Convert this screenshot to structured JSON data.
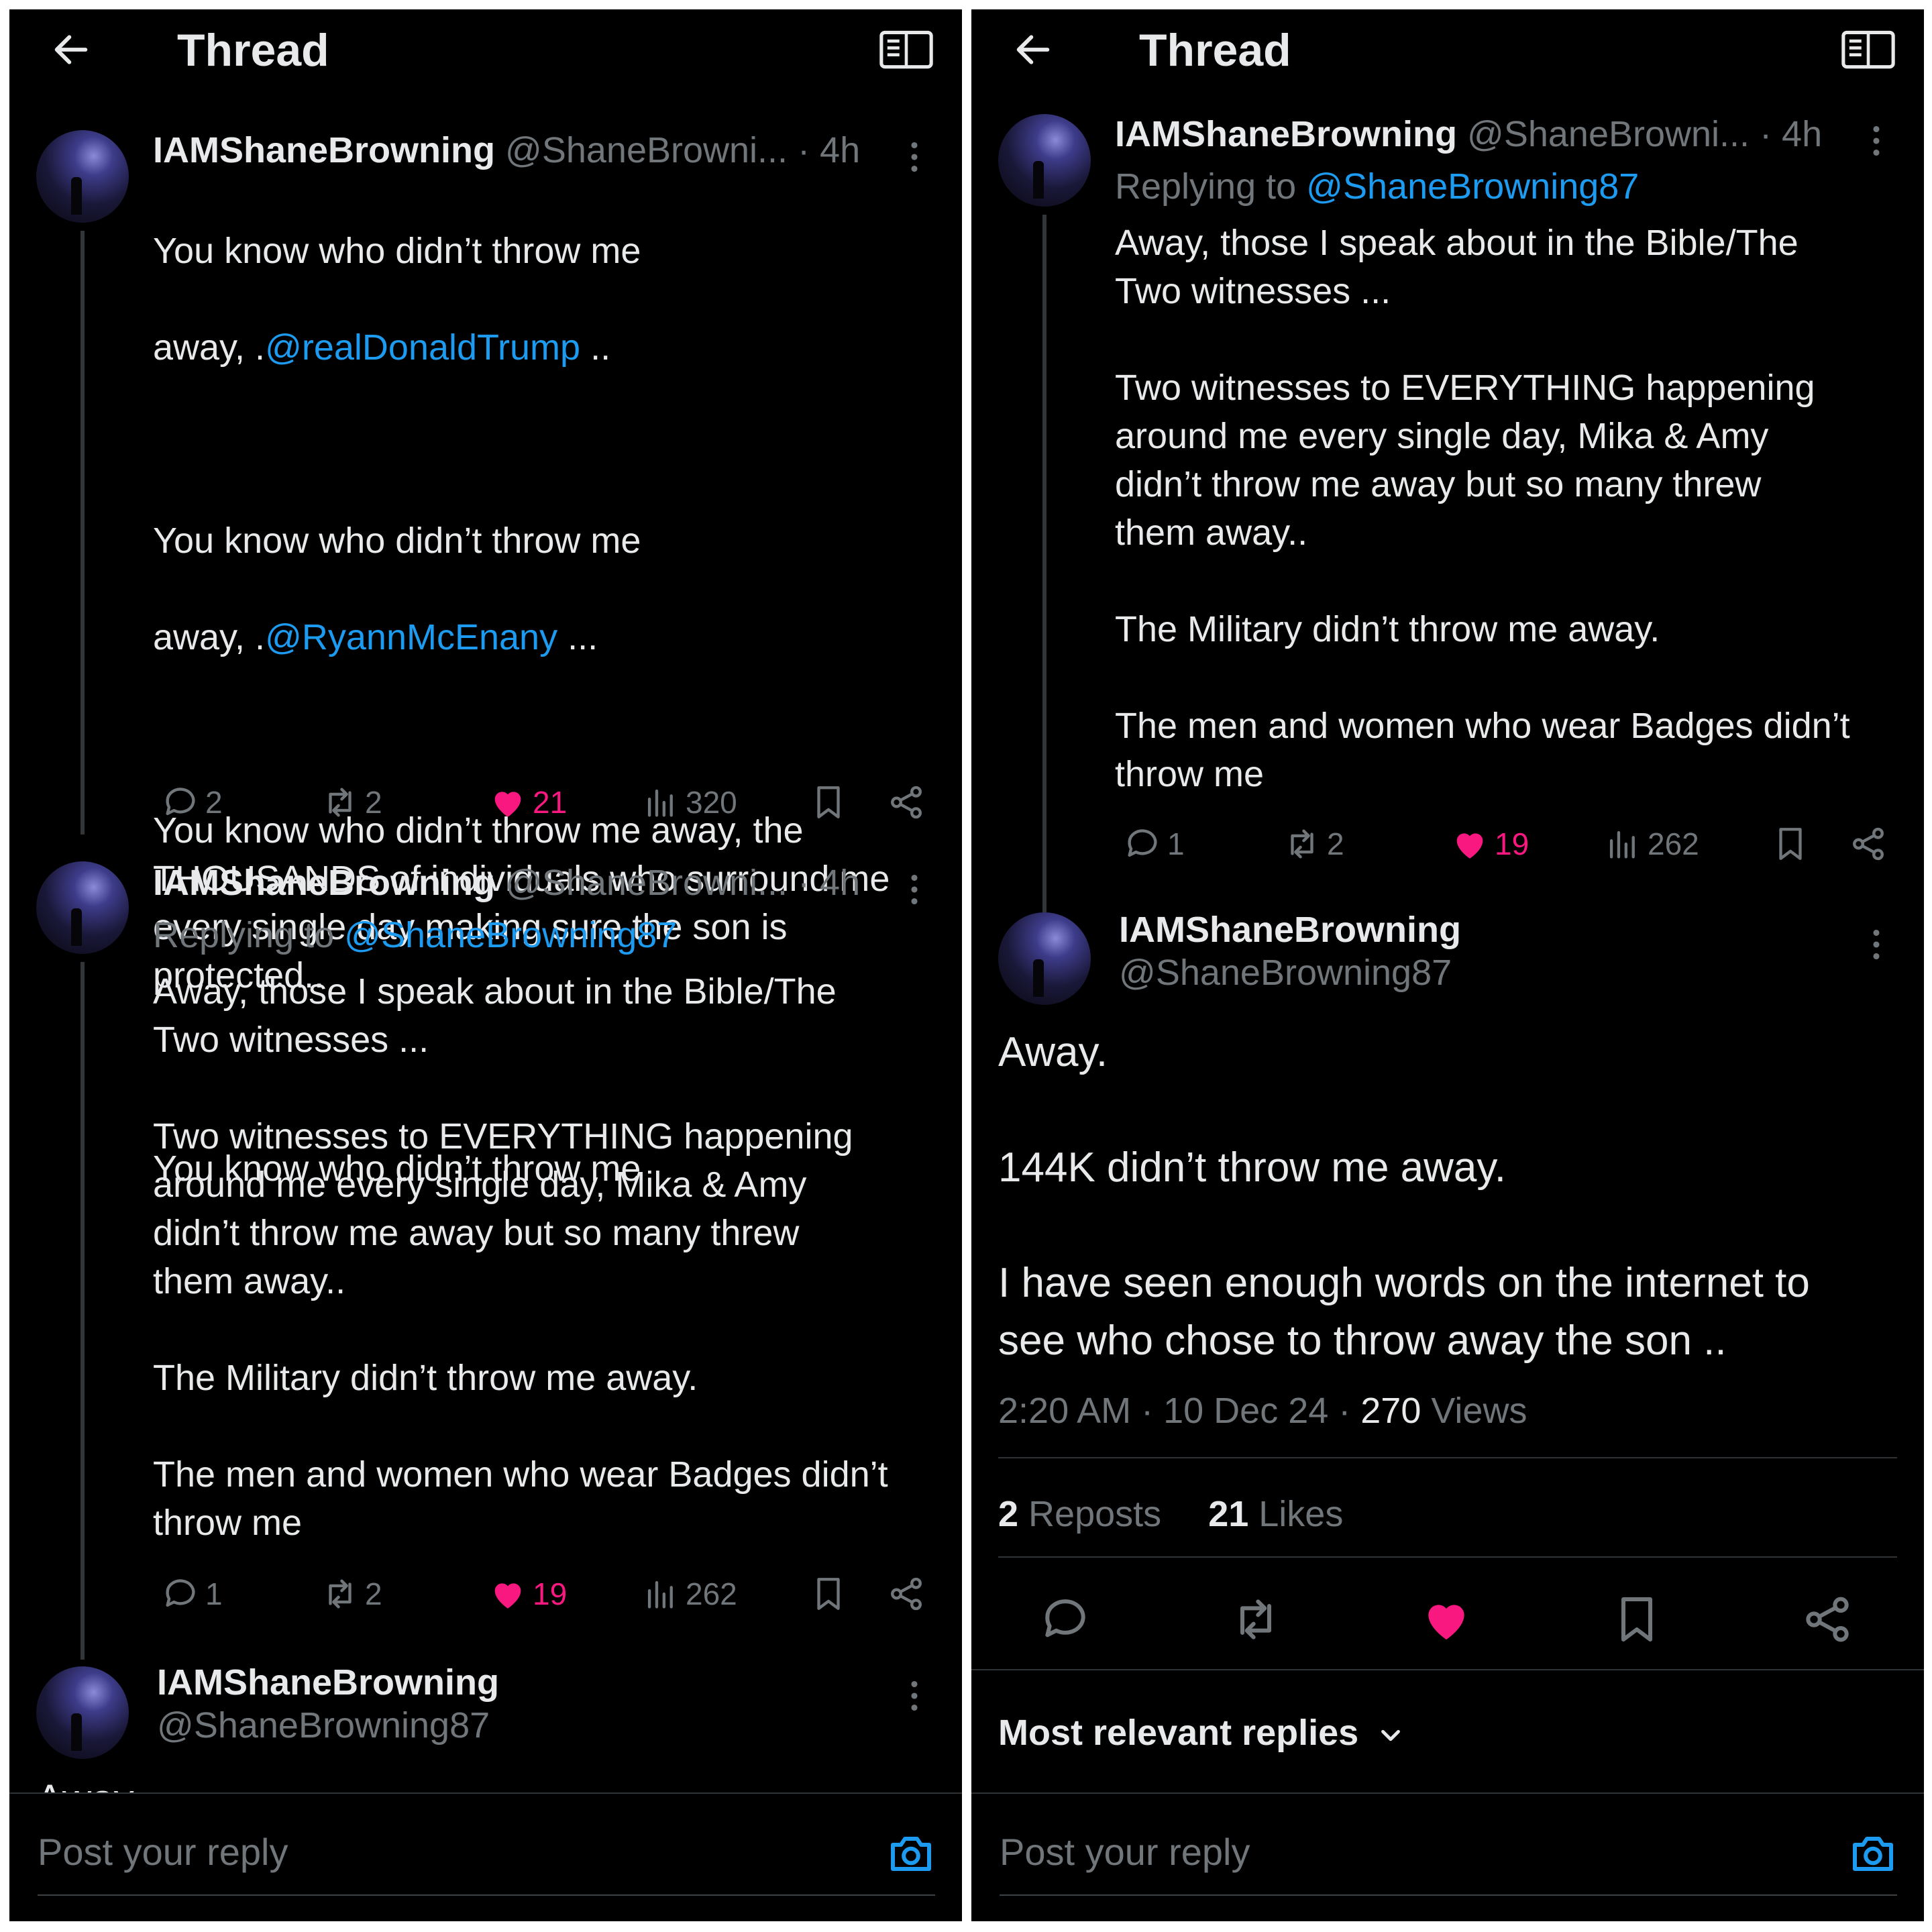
{
  "header": {
    "title": "Thread"
  },
  "left": {
    "tweet1": {
      "name": "IAMShaneBrowning",
      "handle": "@ShaneBrowni...",
      "time": "· 4h",
      "p1a": "You know who didn’t throw me",
      "p1b": "away, .",
      "p1link": "@realDonaldTrump",
      "p1end": " ..",
      "p2a": "You know who didn’t throw me",
      "p2b": "away, .",
      "p2link": "@RyannMcEnany",
      "p2end": "  ...",
      "p3": "You know who didn’t throw me away, the\nTHOUSANDS of individuals who surround me\nevery single day making sure the son is\nprotected..",
      "p4": "You know who didn’t throw me",
      "replies": "2",
      "reposts": "2",
      "likes": "21",
      "views": "320"
    },
    "tweet2": {
      "name": "IAMShaneBrowning",
      "handle": "@ShaneBrowni...",
      "time": "· 4h",
      "replying_prefix": "Replying to ",
      "replying_to": "@ShaneBrowning87",
      "text": "Away, those I speak about in the Bible/The\nTwo witnesses ...\n\nTwo witnesses to EVERYTHING happening\naround me every single day, Mika & Amy\ndidn’t throw me away but so many threw\nthem away..\n\nThe Military didn’t throw me away.\n\nThe men and women who wear Badges didn’t\nthrow me",
      "replies": "1",
      "reposts": "2",
      "likes": "19",
      "views": "262"
    },
    "tweet3": {
      "name": "IAMShaneBrowning",
      "handle": "@ShaneBrowning87",
      "peek": "Away."
    },
    "composer": {
      "placeholder": "Post your reply"
    }
  },
  "right": {
    "tweet2": {
      "name": "IAMShaneBrowning",
      "handle": "@ShaneBrowni...",
      "time": "· 4h",
      "replying_prefix": "Replying to ",
      "replying_to": "@ShaneBrowning87",
      "text": "Away, those I speak about in the Bible/The\nTwo witnesses ...\n\nTwo witnesses to EVERYTHING happening\naround me every single day, Mika & Amy\ndidn’t throw me away but so many threw\nthem away..\n\nThe Military didn’t throw me away.\n\nThe men and women who wear Badges didn’t\nthrow me",
      "replies": "1",
      "reposts": "2",
      "likes": "19",
      "views": "262"
    },
    "main": {
      "name": "IAMShaneBrowning",
      "handle": "@ShaneBrowning87",
      "text": "Away.\n\n144K didn’t throw me away.\n\nI have seen enough words on the internet to\nsee who chose to throw away the son ..",
      "time": "2:20 AM · 10 Dec 24 · ",
      "views_count": "270",
      "views_label": " Views",
      "reposts_count": "2",
      "reposts_label": " Reposts",
      "likes_count": "21",
      "likes_label": " Likes"
    },
    "replies_sort": "Most relevant replies",
    "composer": {
      "placeholder": "Post your reply"
    }
  },
  "icons": {
    "back": "arrow-left-icon",
    "reader": "book-open-icon",
    "reply": "speech-bubble-icon",
    "repost": "repost-arrows-icon",
    "like": "heart-icon",
    "views": "bar-chart-icon",
    "bookmark": "bookmark-icon",
    "share": "share-icon",
    "more": "more-vertical-icon",
    "camera": "camera-icon"
  },
  "colors": {
    "background": "#000000",
    "text": "#e7e9ea",
    "muted": "#71767b",
    "link": "#1d9bf0",
    "like": "#f91880",
    "divider": "#2f3336"
  }
}
